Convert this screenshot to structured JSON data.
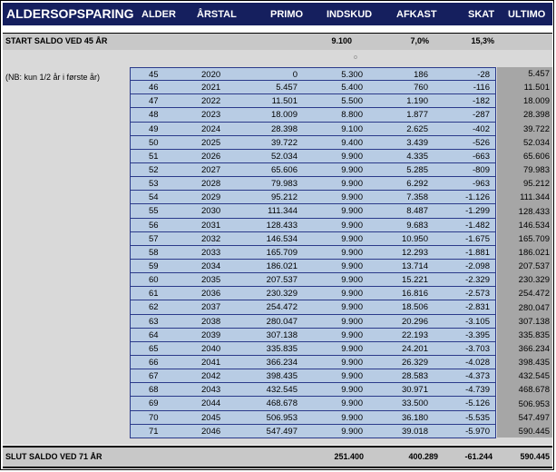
{
  "title": "ALDERSOPSPARING",
  "headers": {
    "alder": "ALDER",
    "aarstal": "ÅRSTAL",
    "primo": "PRIMO",
    "indskud": "INDSKUD",
    "afkast": "AFKAST",
    "skat": "SKAT",
    "ultimo": "ULTIMO"
  },
  "start": {
    "label": "START SALDO VED 45 ÅR",
    "indskud": "9.100",
    "afkast": "7,0%",
    "skat": "15,3%"
  },
  "note": "(NB: kun 1/2 år i første år)",
  "small_mark": "o",
  "rows": [
    [
      "45",
      "2020",
      "0",
      "5.300",
      "186",
      "-28",
      "5.457"
    ],
    [
      "46",
      "2021",
      "5.457",
      "5.400",
      "760",
      "-116",
      "11.501"
    ],
    [
      "47",
      "2022",
      "11.501",
      "5.500",
      "1.190",
      "-182",
      "18.009"
    ],
    [
      "48",
      "2023",
      "18.009",
      "8.800",
      "1.877",
      "-287",
      "28.398"
    ],
    [
      "49",
      "2024",
      "28.398",
      "9.100",
      "2.625",
      "-402",
      "39.722"
    ],
    [
      "50",
      "2025",
      "39.722",
      "9.400",
      "3.439",
      "-526",
      "52.034"
    ],
    [
      "51",
      "2026",
      "52.034",
      "9.900",
      "4.335",
      "-663",
      "65.606"
    ],
    [
      "52",
      "2027",
      "65.606",
      "9.900",
      "5.285",
      "-809",
      "79.983"
    ],
    [
      "53",
      "2028",
      "79.983",
      "9.900",
      "6.292",
      "-963",
      "95.212"
    ],
    [
      "54",
      "2029",
      "95.212",
      "9.900",
      "7.358",
      "-1.126",
      "111.344"
    ],
    [
      "55",
      "2030",
      "111.344",
      "9.900",
      "8.487",
      "-1.299",
      "128.433"
    ],
    [
      "56",
      "2031",
      "128.433",
      "9.900",
      "9.683",
      "-1.482",
      "146.534"
    ],
    [
      "57",
      "2032",
      "146.534",
      "9.900",
      "10.950",
      "-1.675",
      "165.709"
    ],
    [
      "58",
      "2033",
      "165.709",
      "9.900",
      "12.293",
      "-1.881",
      "186.021"
    ],
    [
      "59",
      "2034",
      "186.021",
      "9.900",
      "13.714",
      "-2.098",
      "207.537"
    ],
    [
      "60",
      "2035",
      "207.537",
      "9.900",
      "15.221",
      "-2.329",
      "230.329"
    ],
    [
      "61",
      "2036",
      "230.329",
      "9.900",
      "16.816",
      "-2.573",
      "254.472"
    ],
    [
      "62",
      "2037",
      "254.472",
      "9.900",
      "18.506",
      "-2.831",
      "280.047"
    ],
    [
      "63",
      "2038",
      "280.047",
      "9.900",
      "20.296",
      "-3.105",
      "307.138"
    ],
    [
      "64",
      "2039",
      "307.138",
      "9.900",
      "22.193",
      "-3.395",
      "335.835"
    ],
    [
      "65",
      "2040",
      "335.835",
      "9.900",
      "24.201",
      "-3.703",
      "366.234"
    ],
    [
      "66",
      "2041",
      "366.234",
      "9.900",
      "26.329",
      "-4.028",
      "398.435"
    ],
    [
      "67",
      "2042",
      "398.435",
      "9.900",
      "28.583",
      "-4.373",
      "432.545"
    ],
    [
      "68",
      "2043",
      "432.545",
      "9.900",
      "30.971",
      "-4.739",
      "468.678"
    ],
    [
      "69",
      "2044",
      "468.678",
      "9.900",
      "33.500",
      "-5.126",
      "506.953"
    ],
    [
      "70",
      "2045",
      "506.953",
      "9.900",
      "36.180",
      "-5.535",
      "547.497"
    ],
    [
      "71",
      "2046",
      "547.497",
      "9.900",
      "39.018",
      "-5.970",
      "590.445"
    ]
  ],
  "slut": {
    "label": "SLUT SALDO VED 71 ÅR",
    "indskud": "251.400",
    "afkast": "400.289",
    "skat": "-61.244",
    "ultimo": "590.445"
  }
}
